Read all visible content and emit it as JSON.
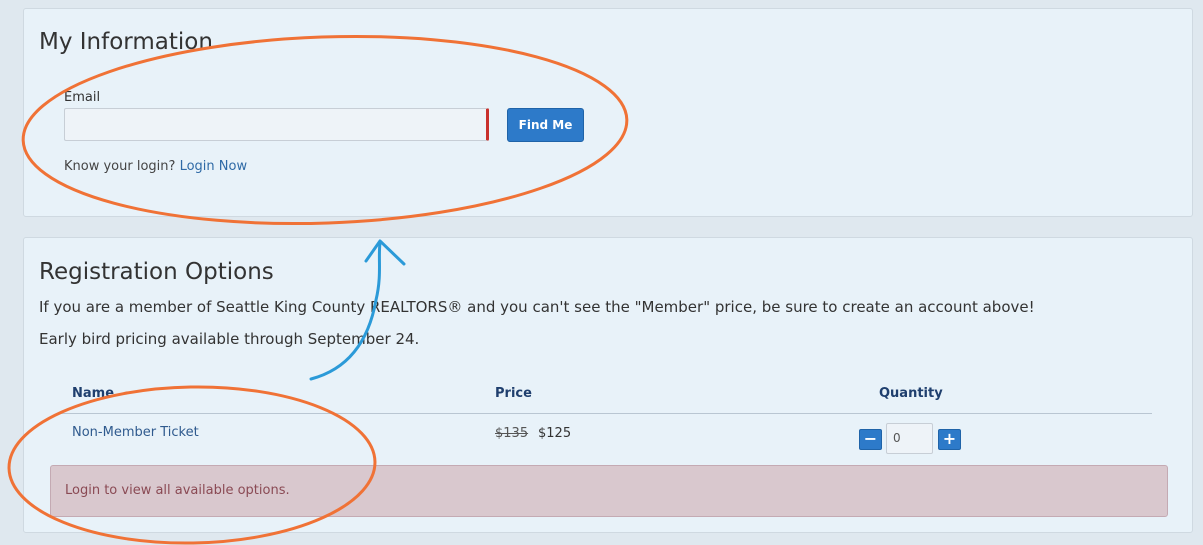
{
  "my_info": {
    "title": "My Information",
    "email_label": "Email",
    "email_value": "",
    "find_button": "Find Me",
    "login_prompt": "Know your login?",
    "login_link": "Login Now"
  },
  "registration": {
    "title": "Registration Options",
    "line1": "If you are a member of Seattle King County REALTORS® and you can't see the \"Member\" price, be sure to create an account above!",
    "line2": "Early bird pricing available through September 24.",
    "columns": {
      "name": "Name",
      "price": "Price",
      "quantity": "Quantity"
    },
    "tickets": [
      {
        "name": "Non-Member Ticket",
        "old_price": "$135",
        "price": "$125",
        "quantity": "0",
        "minus": "−",
        "plus": "+"
      }
    ],
    "alert": "Login to view all available options."
  },
  "colors": {
    "accent": "#2d7ac9",
    "annotation_circle": "#f07236",
    "annotation_arrow": "#2b9ad8"
  }
}
